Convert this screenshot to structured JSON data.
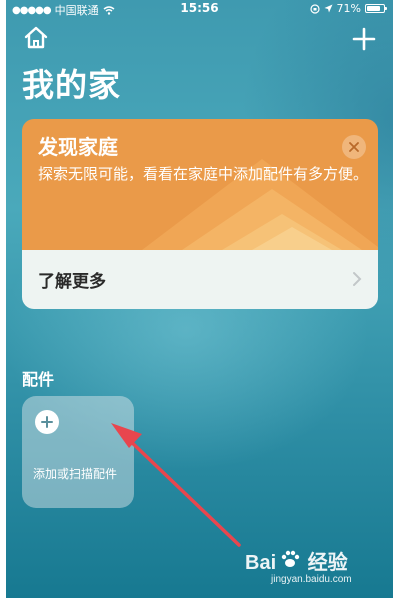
{
  "status_bar": {
    "carrier": "中国联通",
    "time": "15:56",
    "battery": "71%"
  },
  "header": {
    "title": "我的家"
  },
  "discover_card": {
    "title": "发现家庭",
    "description": "探索无限可能，看看在家庭中添加配件有多方便。",
    "link_label": "了解更多"
  },
  "accessories": {
    "section_label": "配件",
    "add_tile_label": "添加或扫描配件"
  },
  "watermark": {
    "logo_text": "Bai 经验",
    "url": "jingyan.baidu.com"
  },
  "colors": {
    "card_orange": "#ea9a49",
    "annotation_arrow": "#e8464e"
  },
  "icons": [
    "home-icon",
    "plus-icon",
    "close-icon",
    "chevron-right-icon",
    "plus-circle-icon",
    "paw-icon"
  ]
}
